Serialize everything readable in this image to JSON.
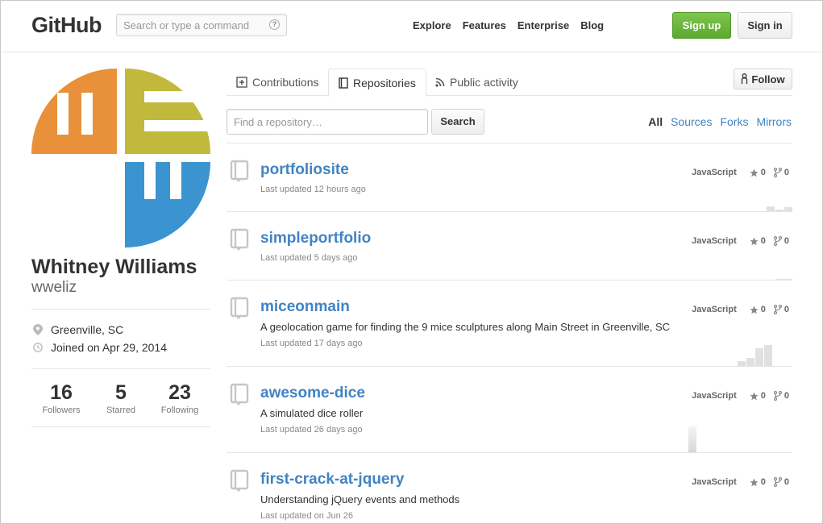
{
  "header": {
    "logo": "GitHub",
    "search_placeholder": "Search or type a command",
    "search_help": "?",
    "nav": [
      "Explore",
      "Features",
      "Enterprise",
      "Blog"
    ],
    "signup_label": "Sign up",
    "signin_label": "Sign in"
  },
  "profile": {
    "full_name": "Whitney Williams",
    "username": "wweliz",
    "location": "Greenville, SC",
    "joined": "Joined on Apr 29, 2014",
    "avatar_colors": [
      "#e8913a",
      "#c1b93b",
      "#3b94d0"
    ],
    "stats": [
      {
        "value": "16",
        "label": "Followers"
      },
      {
        "value": "5",
        "label": "Starred"
      },
      {
        "value": "23",
        "label": "Following"
      }
    ]
  },
  "tabs": [
    {
      "label": "Contributions",
      "icon": "plus-square-icon"
    },
    {
      "label": "Repositories",
      "icon": "book-icon"
    },
    {
      "label": "Public activity",
      "icon": "rss-icon"
    }
  ],
  "follow_label": "Follow",
  "repo_search": {
    "placeholder": "Find a repository…",
    "button": "Search"
  },
  "filters": [
    "All",
    "Sources",
    "Forks",
    "Mirrors"
  ],
  "repos": [
    {
      "name": "portfoliosite",
      "description": "",
      "updated": "Last updated 12 hours ago",
      "language": "JavaScript",
      "stars": "0",
      "forks": "0"
    },
    {
      "name": "simpleportfolio",
      "description": "",
      "updated": "Last updated 5 days ago",
      "language": "JavaScript",
      "stars": "0",
      "forks": "0"
    },
    {
      "name": "miceonmain",
      "description": "A geolocation game for finding the 9 mice sculptures along Main Street in Greenville, SC",
      "updated": "Last updated 17 days ago",
      "language": "JavaScript",
      "stars": "0",
      "forks": "0"
    },
    {
      "name": "awesome-dice",
      "description": "A simulated dice roller",
      "updated": "Last updated 26 days ago",
      "language": "JavaScript",
      "stars": "0",
      "forks": "0"
    },
    {
      "name": "first-crack-at-jquery",
      "description": "Understanding jQuery events and methods",
      "updated": "Last updated on Jun 26",
      "language": "JavaScript",
      "stars": "0",
      "forks": "0"
    }
  ],
  "colors": {
    "link": "#4183c4",
    "signup_green": "#6cc644"
  }
}
